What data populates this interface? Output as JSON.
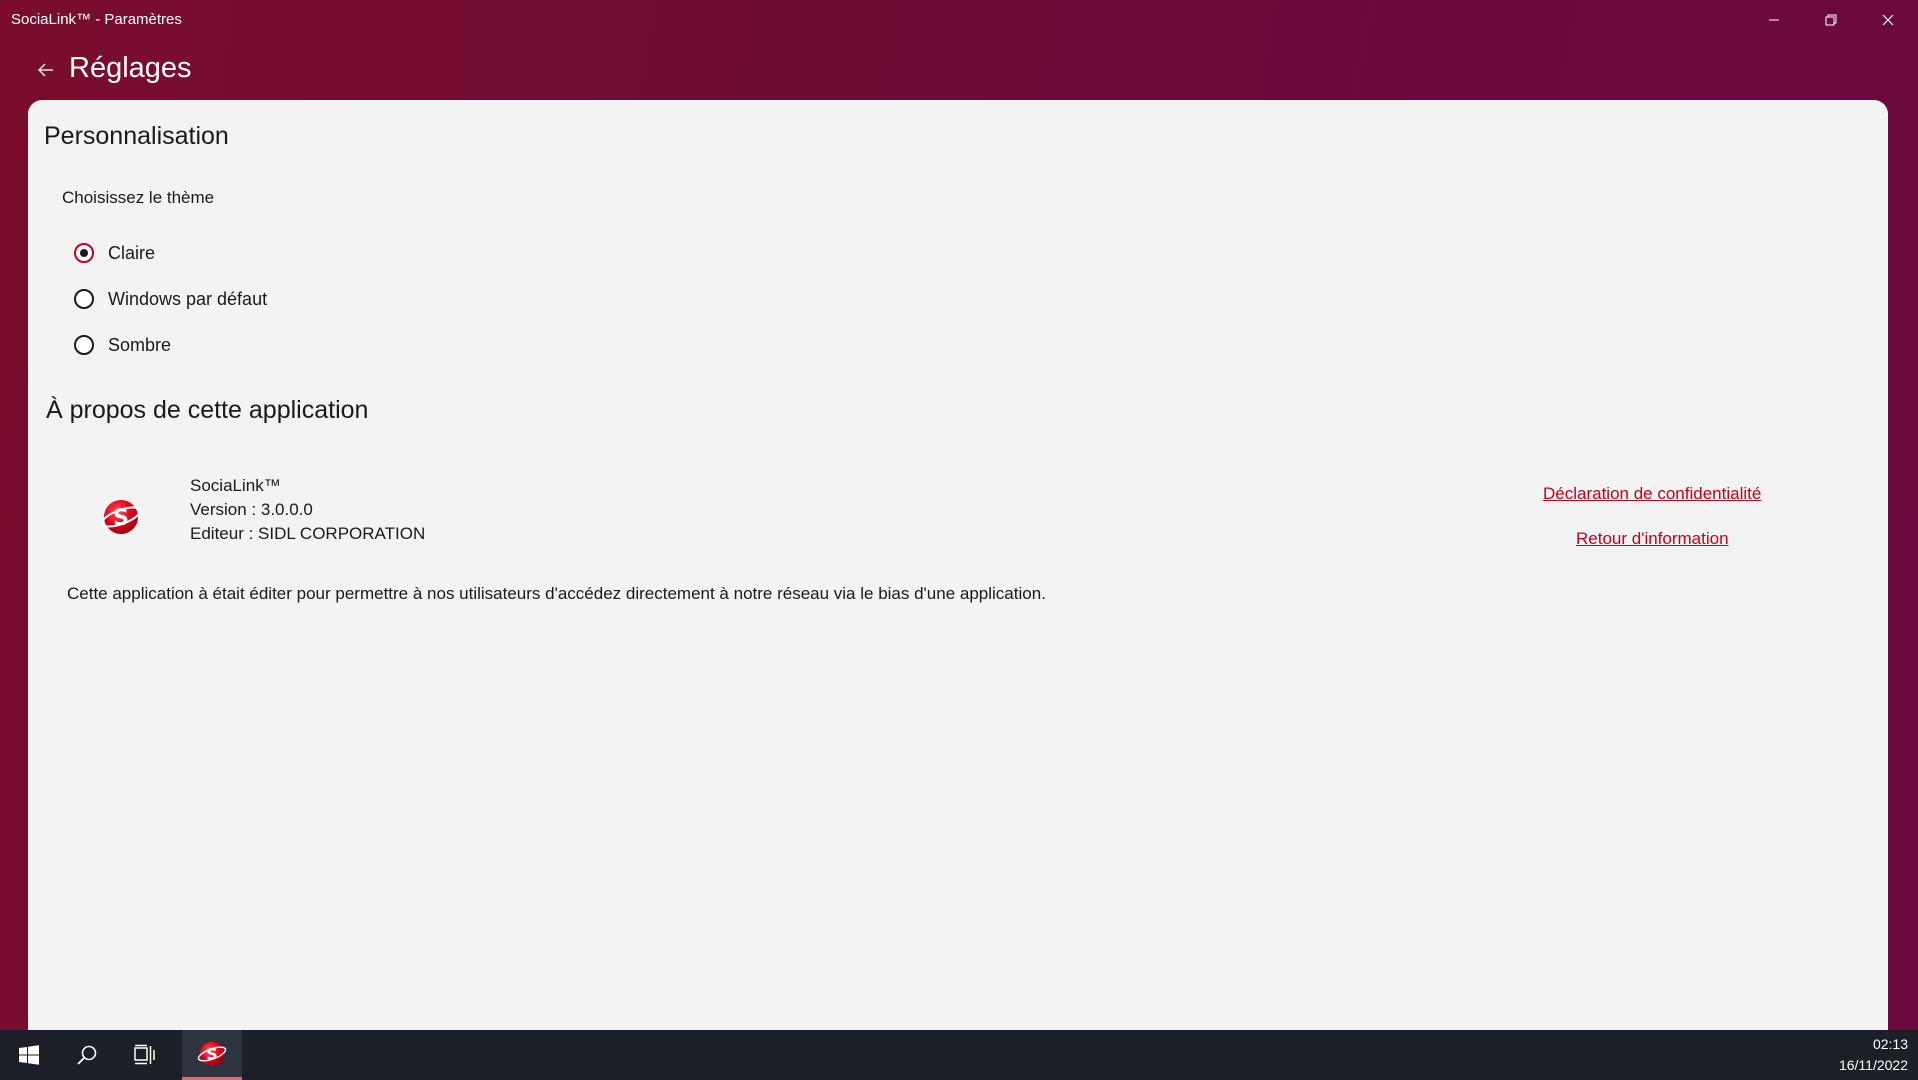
{
  "window": {
    "title": "SociaLink™ - Paramètres",
    "controls": [
      "minimize-icon",
      "restore-icon",
      "close-icon"
    ]
  },
  "header": {
    "back_icon": "arrow-left-icon",
    "title": "Réglages"
  },
  "personalization": {
    "title": "Personnalisation",
    "theme_label": "Choisissez le thème",
    "options": [
      {
        "label": "Claire",
        "checked": true
      },
      {
        "label": "Windows par défaut",
        "checked": false
      },
      {
        "label": "Sombre",
        "checked": false
      }
    ]
  },
  "about": {
    "title": "À propos de cette application",
    "app_name": "SociaLink™",
    "version": "Version : 3.0.0.0",
    "publisher": "Editeur : SIDL CORPORATION",
    "privacy_link": "Déclaration de confidentialité",
    "feedback_link": "Retour d'information",
    "description": "Cette application à était éditer pour permettre à nos utilisateurs d'accédez directement à notre réseau via le bias d'une application."
  },
  "taskbar": {
    "items": [
      "windows-start-icon",
      "search-icon",
      "task-view-icon",
      "socialink-app-icon"
    ],
    "time": "02:13",
    "date": "16/11/2022"
  },
  "colors": {
    "accent": "#c4001f",
    "card_background": "#f3f3f3",
    "taskbar_background": "#1c1f27"
  }
}
